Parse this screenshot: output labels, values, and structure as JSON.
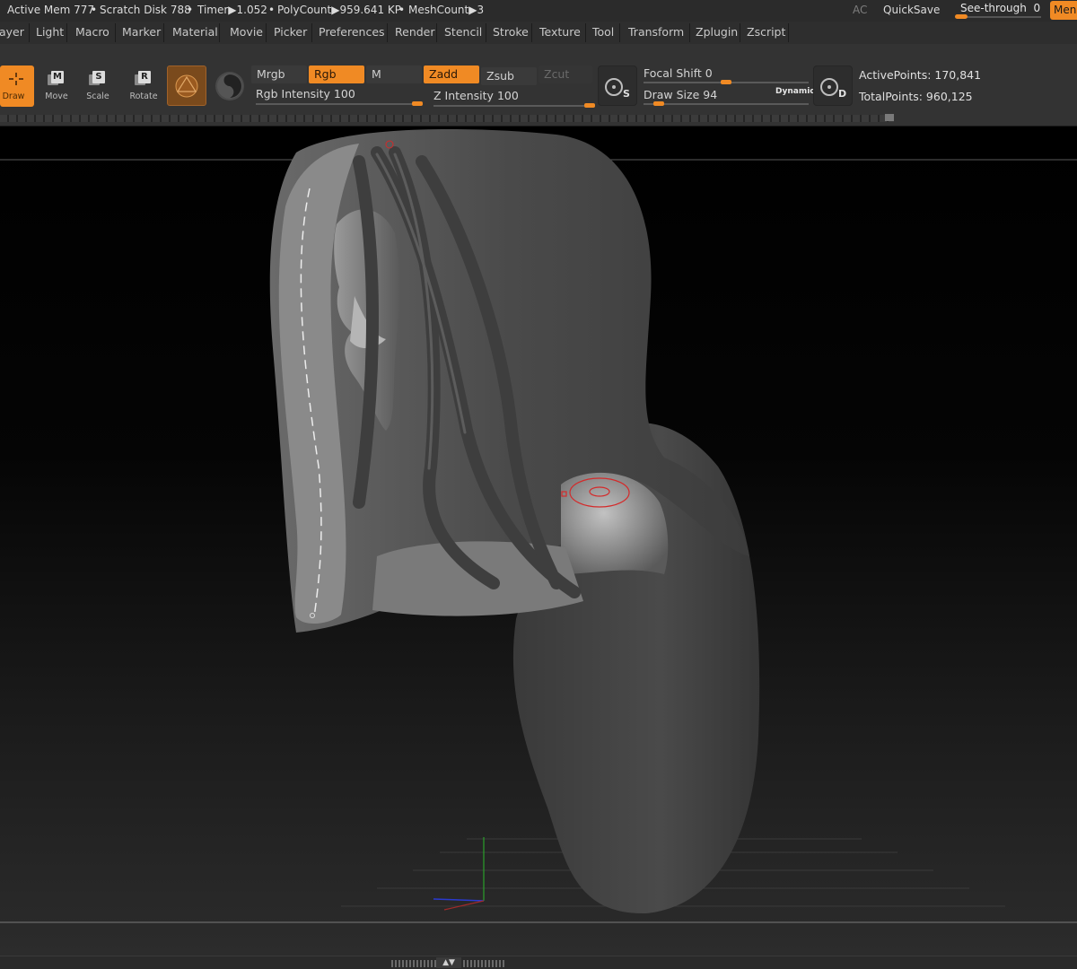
{
  "status": {
    "active_mem": "Active Mem 777",
    "scratch_disk": "Scratch Disk 788",
    "timer": "Timer▶1.052",
    "polycount": "PolyCount▶959.641 KP",
    "meshcount": "MeshCount▶3",
    "ac": "AC",
    "quicksave": "QuickSave",
    "see_through_label": "See-through",
    "see_through_value": "0",
    "see_through_level": 0,
    "menu_label": "Menu"
  },
  "menus": [
    "Layer",
    "Light",
    "Macro",
    "Marker",
    "Material",
    "Movie",
    "Picker",
    "Preferences",
    "Render",
    "Stencil",
    "Stroke",
    "Texture",
    "Tool",
    "Transform",
    "Zplugin",
    "Zscript"
  ],
  "tools": {
    "draw": "Draw",
    "move": "Move",
    "scale": "Scale",
    "rotate": "Rotate",
    "move_letter": "M",
    "scale_letter": "S",
    "rotate_letter": "R"
  },
  "modes": {
    "mrgb": "Mrgb",
    "rgb": "Rgb",
    "m": "M",
    "zadd": "Zadd",
    "zsub": "Zsub",
    "zcut": "Zcut"
  },
  "sliders": {
    "rgb_intensity": {
      "label": "Rgb Intensity",
      "value": 100
    },
    "z_intensity": {
      "label": "Z Intensity",
      "value": 100
    },
    "focal_shift": {
      "label": "Focal Shift",
      "value": 0
    },
    "draw_size": {
      "label": "Draw Size",
      "value": 94
    }
  },
  "stroke_buttons": {
    "s_label": "S",
    "d_label": "D",
    "dynamic": "Dynamic"
  },
  "info": {
    "active_points": "ActivePoints: 170,841",
    "total_points": "TotalPoints: 960,125"
  },
  "colors": {
    "accent": "#f08a24",
    "panel": "#333333",
    "cursor": "#d42a2a"
  }
}
